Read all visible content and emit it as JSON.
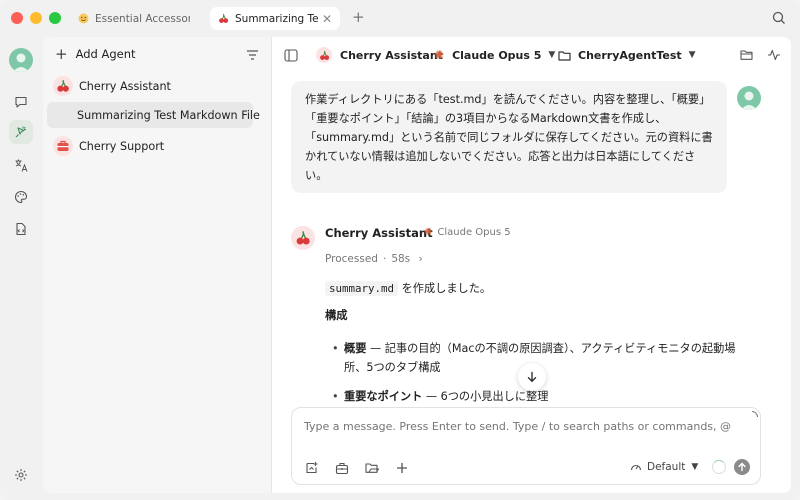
{
  "tabs": [
    {
      "label": "Essential Accessories",
      "icon": "emoji-icon"
    },
    {
      "label": "Summarizing Test",
      "icon": "cherry-icon",
      "close": "✕"
    }
  ],
  "sidebar": {
    "add_agent_label": "Add Agent",
    "items": [
      {
        "label": "Cherry Assistant",
        "avatar": "cherry-icon"
      },
      {
        "label": "Summarizing Test Markdown File",
        "avatar": ""
      },
      {
        "label": "Cherry Support",
        "avatar": "toolbox-icon"
      }
    ]
  },
  "toolbar": {
    "agent_label": "Cherry Assistant",
    "model_label": "Claude Opus 5",
    "folder_label": "CherryAgentTest"
  },
  "user_message": {
    "text": "作業ディレクトリにある「test.md」を読んでください。内容を整理し、「概要」「重要なポイント」「結論」の3項目からなるMarkdown文書を作成し、「summary.md」という名前で同じフォルダに保存してください。元の資料に書かれていない情報は追加しないでください。応答と出力は日本語にしてください。"
  },
  "assistant": {
    "name": "Cherry Assistant",
    "model": "Claude Opus 5",
    "processed_label": "Processed",
    "processed_time": "58s",
    "created_file": "summary.md",
    "created_suffix": "を作成しました。",
    "section_heading": "構成",
    "bullets": [
      {
        "term": "概要",
        "text": " — 記事の目的（Macの不調の原因調査）、アクティビティモニタの起動場所、5つのタブ構成"
      },
      {
        "term": "重要なポイント",
        "text": " — 6つの小見出しに整理"
      }
    ]
  },
  "composer": {
    "placeholder": "Type a message. Press Enter to send. Type / to search paths or commands, @ ...",
    "mode_label": "Default"
  },
  "colors": {
    "accent_green": "#7ec8a7",
    "cherry_red": "#d93a3a",
    "claude_orange": "#d9613a"
  }
}
